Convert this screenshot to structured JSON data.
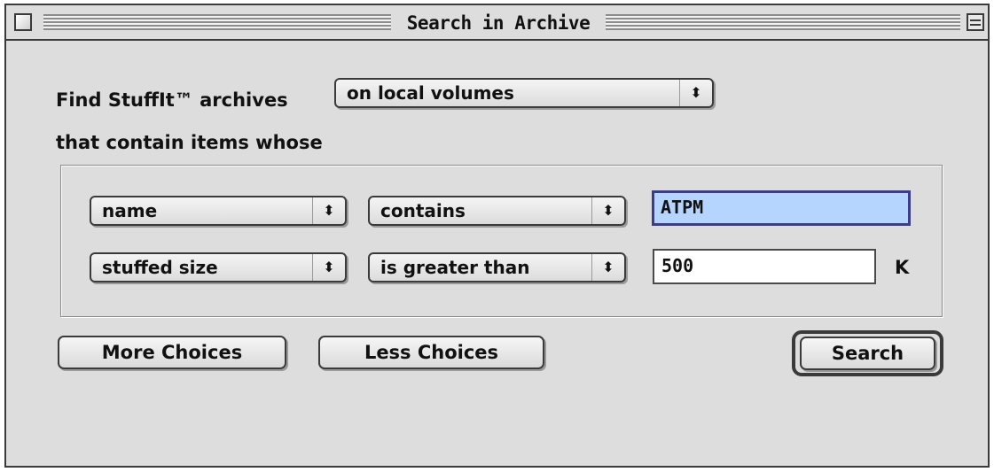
{
  "window": {
    "title": "Search in Archive"
  },
  "find": {
    "prefix": "Find StuffIt™ archives",
    "location_value": "on local volumes",
    "suffix": "that contain items whose"
  },
  "criteria": [
    {
      "attribute": "name",
      "operator": "contains",
      "value": "ATPM",
      "unit": ""
    },
    {
      "attribute": "stuffed size",
      "operator": "is greater than",
      "value": "500",
      "unit": "K"
    }
  ],
  "buttons": {
    "more": "More Choices",
    "less": "Less Choices",
    "search": "Search"
  },
  "icons": {
    "popup_arrows": "⬍"
  },
  "colors": {
    "window_bg": "#dddddd",
    "focus_field_bg": "#b5d5ff",
    "focus_border": "#3b3d8a"
  }
}
